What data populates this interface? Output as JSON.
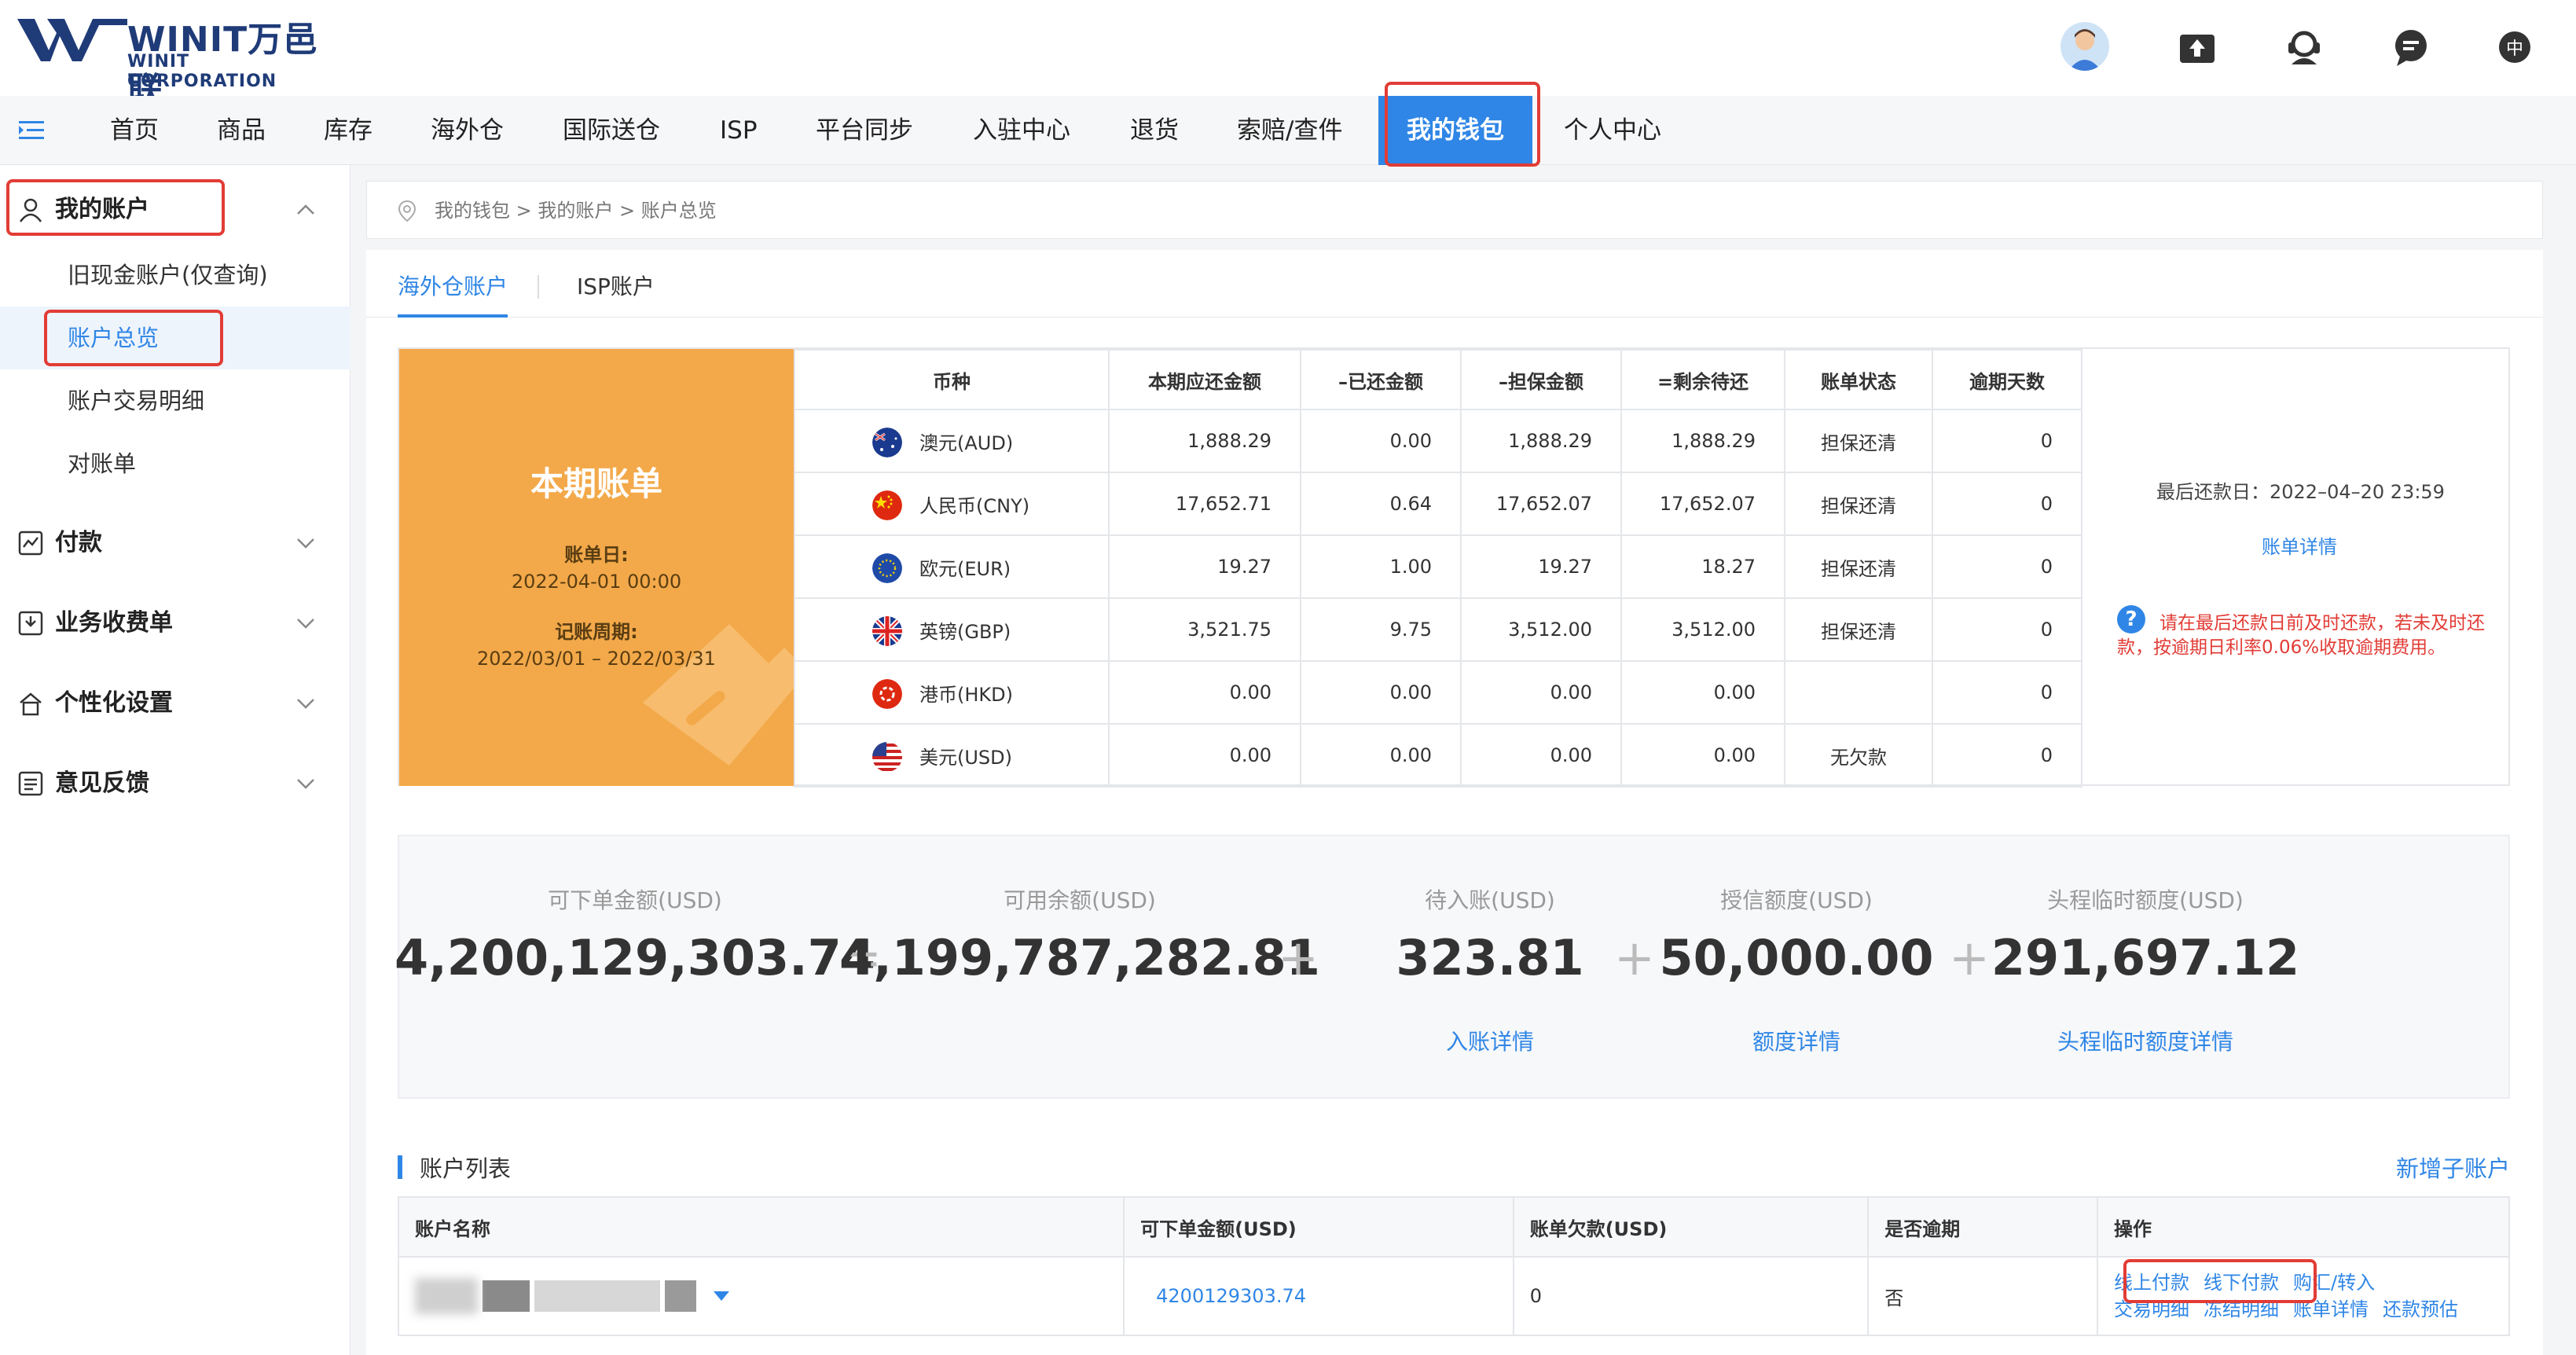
{
  "header": {
    "logo_main": "WINIT万邑联",
    "logo_sub": "WINIT CORPORATION",
    "lang": "中"
  },
  "nav": {
    "items": [
      "首页",
      "商品",
      "库存",
      "海外仓",
      "国际送仓",
      "ISP",
      "平台同步",
      "入驻中心",
      "退货",
      "索赔/查件",
      "我的钱包",
      "个人中心"
    ],
    "active": "我的钱包"
  },
  "sidebar": {
    "my_account": "我的账户",
    "items": [
      "旧现金账户(仅查询)",
      "账户总览",
      "账户交易明细",
      "对账单"
    ],
    "groups": [
      "付款",
      "业务收费单",
      "个性化设置",
      "意见反馈"
    ]
  },
  "breadcrumb": "我的钱包 > 我的账户 > 账户总览",
  "tabs": [
    "海外仓账户",
    "ISP账户"
  ],
  "bill": {
    "title": "本期账单",
    "bill_date_label": "账单日:",
    "bill_date": "2022-04-01 00:00",
    "period_label": "记账周期:",
    "period": "2022/03/01 – 2022/03/31",
    "headers": [
      "币种",
      "本期应还金额",
      "–已还金额",
      "–担保金额",
      "=剩余待还",
      "账单状态",
      "逾期天数"
    ],
    "rows": [
      {
        "currency": "澳元(AUD)",
        "flag": "au",
        "due": "1,888.29",
        "paid": "0.00",
        "guarantee": "1,888.29",
        "remaining": "1,888.29",
        "status": "担保还清",
        "overdue": "0"
      },
      {
        "currency": "人民币(CNY)",
        "flag": "cn",
        "due": "17,652.71",
        "paid": "0.64",
        "guarantee": "17,652.07",
        "remaining": "17,652.07",
        "status": "担保还清",
        "overdue": "0"
      },
      {
        "currency": "欧元(EUR)",
        "flag": "eu",
        "due": "19.27",
        "paid": "1.00",
        "guarantee": "19.27",
        "remaining": "18.27",
        "status": "担保还清",
        "overdue": "0"
      },
      {
        "currency": "英镑(GBP)",
        "flag": "gb",
        "due": "3,521.75",
        "paid": "9.75",
        "guarantee": "3,512.00",
        "remaining": "3,512.00",
        "status": "担保还清",
        "overdue": "0"
      },
      {
        "currency": "港币(HKD)",
        "flag": "hk",
        "due": "0.00",
        "paid": "0.00",
        "guarantee": "0.00",
        "remaining": "0.00",
        "status": "",
        "overdue": "0"
      },
      {
        "currency": "美元(USD)",
        "flag": "us",
        "due": "0.00",
        "paid": "0.00",
        "guarantee": "0.00",
        "remaining": "0.00",
        "status": "无欠款",
        "overdue": "0"
      }
    ],
    "last_due": "最后还款日：2022–04–20 23:59",
    "detail_link": "账单详情",
    "warning": "请在最后还款日前及时还款，若未及时还款，按逾期日利率0.06%收取逾期费用。"
  },
  "summary": {
    "items": [
      {
        "label": "可下单金额(USD)",
        "value": "4,200,129,303.74"
      },
      {
        "label": "可用余额(USD)",
        "value": "4,199,787,282.81"
      },
      {
        "label": "待入账(USD)",
        "value": "323.81",
        "link": "入账详情"
      },
      {
        "label": "授信额度(USD)",
        "value": "50,000.00",
        "link": "额度详情"
      },
      {
        "label": "头程临时额度(USD)",
        "value": "291,697.12",
        "link": "头程临时额度详情"
      }
    ],
    "ops": [
      "=",
      "+",
      "+",
      "+"
    ]
  },
  "account_list": {
    "title": "账户列表",
    "add_link": "新增子账户",
    "headers": [
      "账户名称",
      "可下单金额(USD)",
      "账单欠款(USD)",
      "是否逾期",
      "操作"
    ],
    "row": {
      "amount": "4200129303.74",
      "debt": "0",
      "overdue": "否",
      "ops_line1": [
        "线上付款",
        "线下付款",
        "购汇/转入"
      ],
      "ops_line2": [
        "交易明细",
        "冻结明细",
        "账单详情",
        "还款预估"
      ]
    }
  }
}
